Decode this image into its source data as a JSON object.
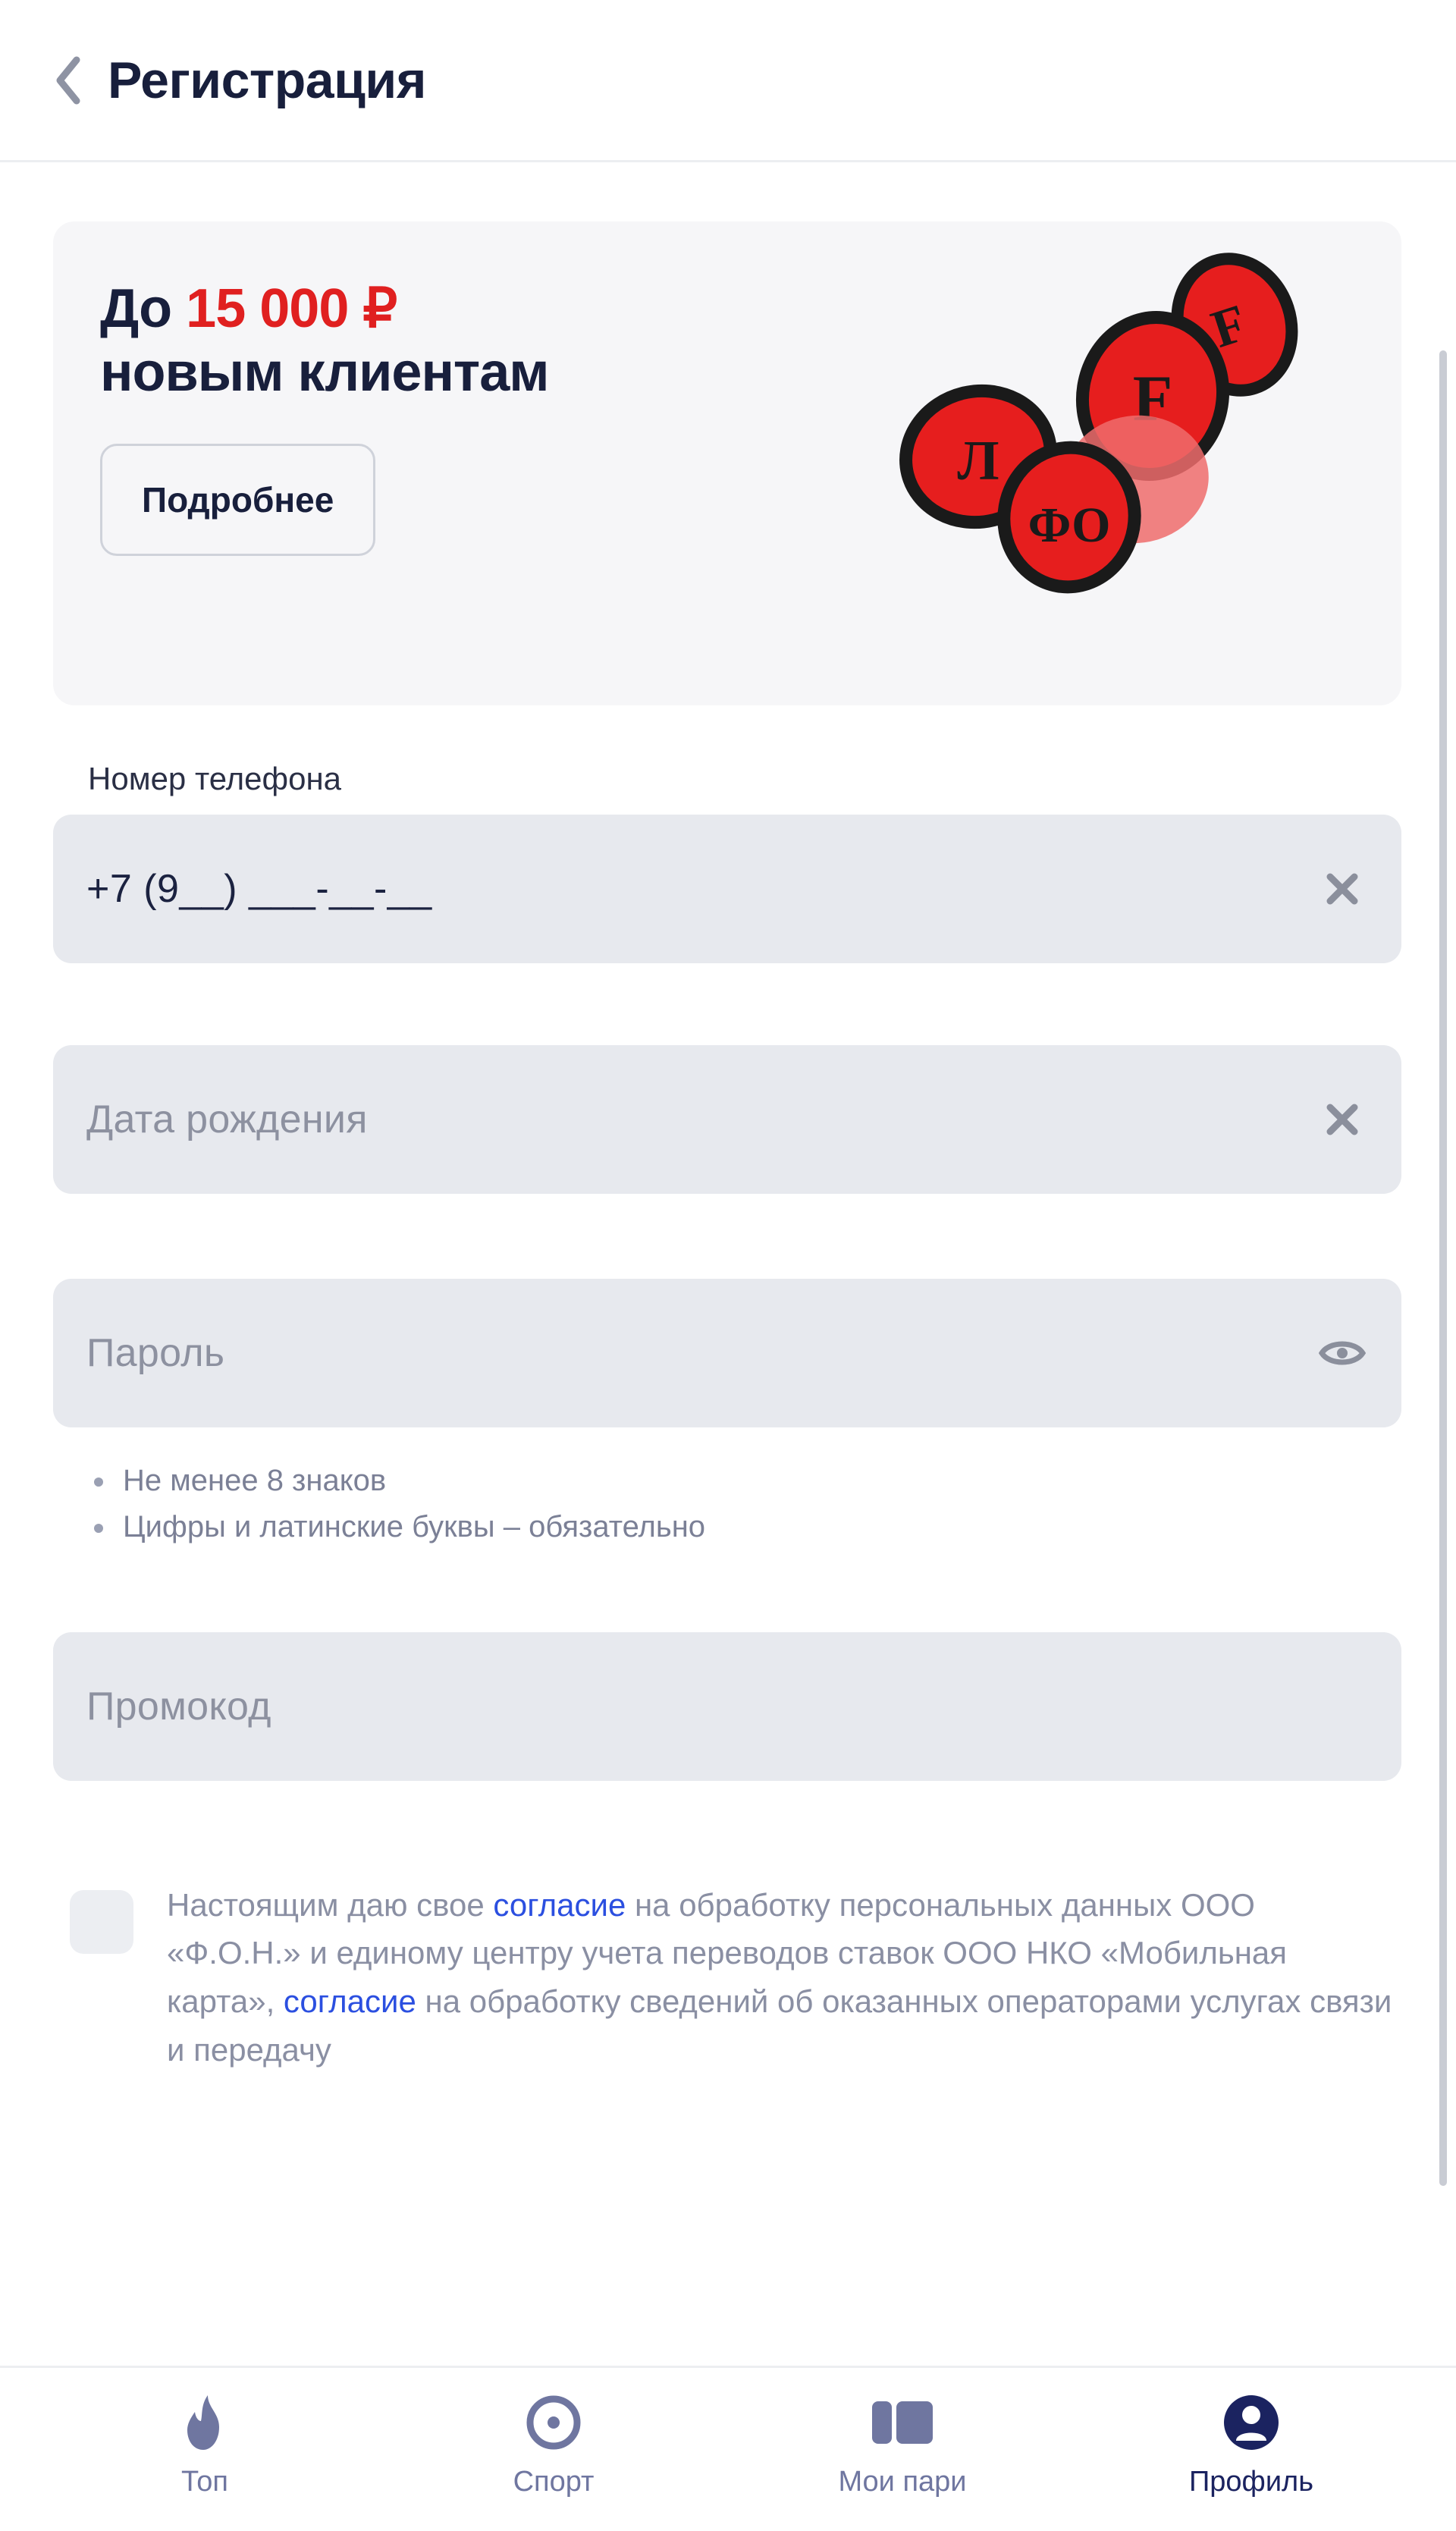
{
  "header": {
    "title": "Регистрация",
    "back_icon": "chevron-left-icon"
  },
  "promo": {
    "title_prefix": "До ",
    "amount": "15 000 ₽",
    "title_suffix": "новым клиентам",
    "button_label": "Подробнее",
    "art_icon": "poker-chips-illustration",
    "accent_color": "#e02020",
    "background_color": "#f6f6f8"
  },
  "form": {
    "phone": {
      "label": "Номер телефона",
      "value": "+7 (9__) ___-__-__",
      "clear_icon": "close-icon"
    },
    "birthdate": {
      "placeholder": "Дата рождения",
      "value": "",
      "clear_icon": "close-icon"
    },
    "password": {
      "placeholder": "Пароль",
      "value": "",
      "toggle_icon": "eye-icon",
      "hints": [
        "Не менее 8 знаков",
        "Цифры и латинские буквы – обязательно"
      ]
    },
    "promocode": {
      "placeholder": "Промокод",
      "value": ""
    }
  },
  "consent": {
    "checked": false,
    "part1": "Настоящим даю свое ",
    "link1": "согласие",
    "part2": " на обработку персональных данных ООО «Ф.О.Н.» и единому центру учета переводов ставок ООО НКО «Мобильная карта», ",
    "link2": "согласие",
    "part3": " на обработку сведений об оказанных операторами услугах связи и передачу",
    "link_color": "#2b4fe0"
  },
  "bottom_nav": {
    "items": [
      {
        "label": "Топ",
        "icon": "flame-icon",
        "active": false
      },
      {
        "label": "Спорт",
        "icon": "target-icon",
        "active": false
      },
      {
        "label": "Мои пари",
        "icon": "ticket-icon",
        "active": false
      },
      {
        "label": "Профиль",
        "icon": "person-icon",
        "active": true
      }
    ],
    "active_color": "#1b2360",
    "inactive_color": "#6f76a0"
  }
}
